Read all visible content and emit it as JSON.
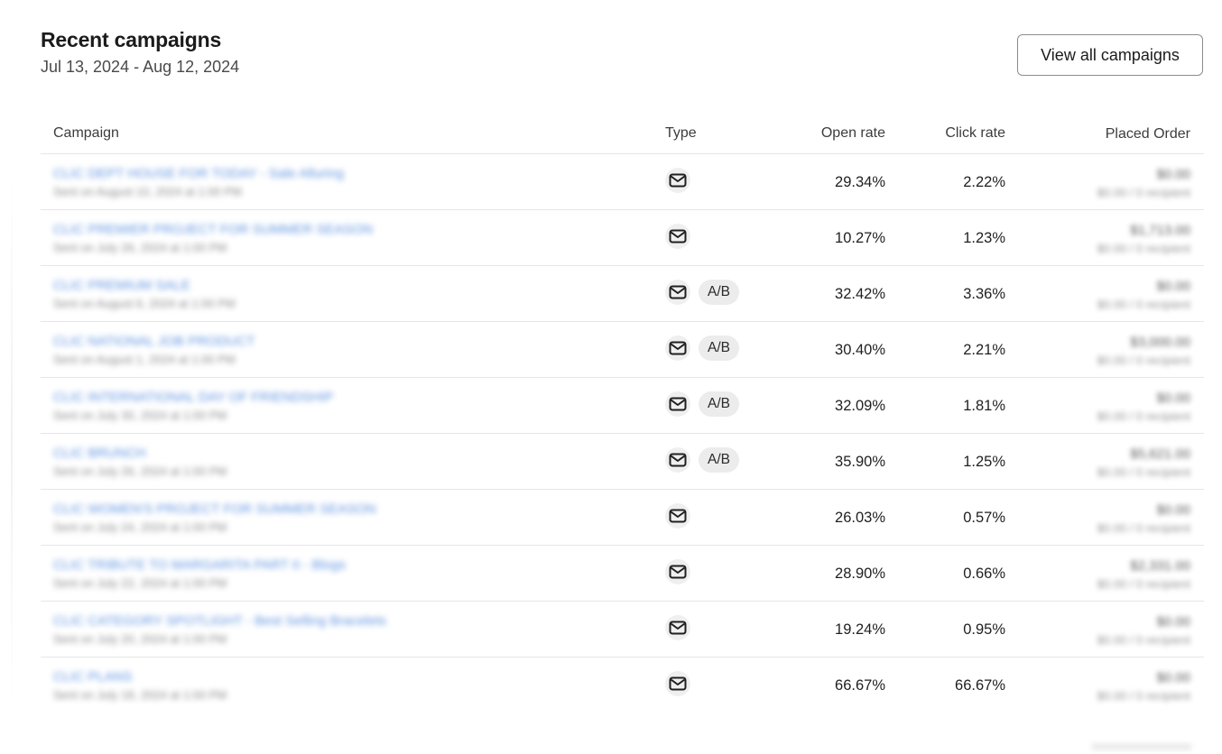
{
  "header": {
    "title": "Recent campaigns",
    "date_range": "Jul 13, 2024 - Aug 12, 2024",
    "view_all_label": "View all campaigns"
  },
  "table": {
    "columns": {
      "campaign": "Campaign",
      "type": "Type",
      "open_rate": "Open rate",
      "click_rate": "Click rate",
      "placed_order": "Placed Order"
    },
    "rows": [
      {
        "name": "CLIC DEPT HOUSE FOR TODAY - Sale Alluring",
        "sent": "Sent on August 10, 2024 at 1:00 PM",
        "type_icon": "mail-icon",
        "ab": "",
        "open_rate": "29.34%",
        "click_rate": "2.22%",
        "order_value": "$0.00",
        "order_count": "$0.00 / 0 recipient"
      },
      {
        "name": "CLIC PREMIER PROJECT FOR SUMMER SEASON",
        "sent": "Sent on July 26, 2024 at 1:00 PM",
        "type_icon": "mail-icon",
        "ab": "",
        "open_rate": "10.27%",
        "click_rate": "1.23%",
        "order_value": "$1,713.00",
        "order_count": "$0.00 / 0 recipient"
      },
      {
        "name": "CLIC PREMIUM SALE",
        "sent": "Sent on August 6, 2024 at 1:00 PM",
        "type_icon": "mail-icon",
        "ab": "A/B",
        "open_rate": "32.42%",
        "click_rate": "3.36%",
        "order_value": "$0.00",
        "order_count": "$0.00 / 0 recipient"
      },
      {
        "name": "CLIC NATIONAL JOB PRODUCT",
        "sent": "Sent on August 1, 2024 at 1:00 PM",
        "type_icon": "mail-icon",
        "ab": "A/B",
        "open_rate": "30.40%",
        "click_rate": "2.21%",
        "order_value": "$3,000.00",
        "order_count": "$0.00 / 0 recipient"
      },
      {
        "name": "CLIC INTERNATIONAL DAY OF FRIENDSHIP",
        "sent": "Sent on July 30, 2024 at 1:00 PM",
        "type_icon": "mail-icon",
        "ab": "A/B",
        "open_rate": "32.09%",
        "click_rate": "1.81%",
        "order_value": "$0.00",
        "order_count": "$0.00 / 0 recipient"
      },
      {
        "name": "CLIC BRUNCH",
        "sent": "Sent on July 26, 2024 at 1:00 PM",
        "type_icon": "mail-icon",
        "ab": "A/B",
        "open_rate": "35.90%",
        "click_rate": "1.25%",
        "order_value": "$5,621.00",
        "order_count": "$0.00 / 0 recipient"
      },
      {
        "name": "CLIC WOMEN'S PROJECT FOR SUMMER SEASON",
        "sent": "Sent on July 24, 2024 at 1:00 PM",
        "type_icon": "mail-icon",
        "ab": "",
        "open_rate": "26.03%",
        "click_rate": "0.57%",
        "order_value": "$0.00",
        "order_count": "$0.00 / 0 recipient"
      },
      {
        "name": "CLIC TRIBUTE TO MARGARITA PART II - Blogs",
        "sent": "Sent on July 22, 2024 at 1:00 PM",
        "type_icon": "mail-icon",
        "ab": "",
        "open_rate": "28.90%",
        "click_rate": "0.66%",
        "order_value": "$2,331.00",
        "order_count": "$0.00 / 0 recipient"
      },
      {
        "name": "CLIC CATEGORY SPOTLIGHT - Best Selling Bracelets",
        "sent": "Sent on July 20, 2024 at 1:00 PM",
        "type_icon": "mail-icon",
        "ab": "",
        "open_rate": "19.24%",
        "click_rate": "0.95%",
        "order_value": "$0.00",
        "order_count": "$0.00 / 0 recipient"
      },
      {
        "name": "CLIC PLANS",
        "sent": "Sent on July 18, 2024 at 1:00 PM",
        "type_icon": "mail-icon",
        "ab": "",
        "open_rate": "66.67%",
        "click_rate": "66.67%",
        "order_value": "$0.00",
        "order_count": "$0.00 / 0 recipient"
      }
    ]
  }
}
